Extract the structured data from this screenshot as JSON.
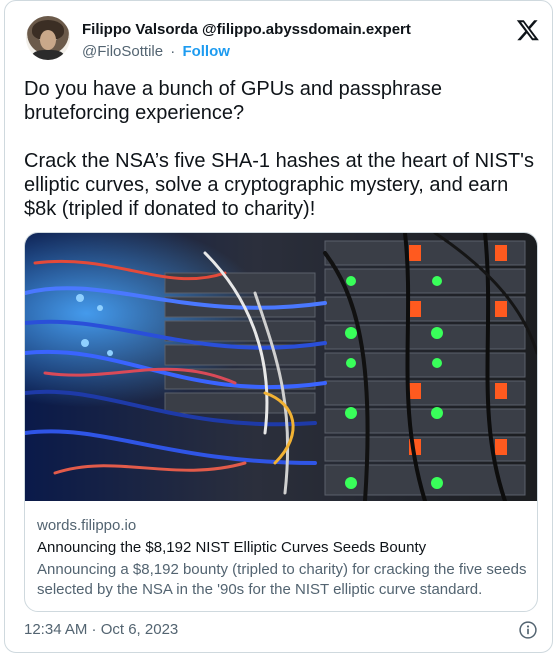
{
  "author": {
    "name": "Filippo Valsorda",
    "handle_display": "@filippo.abyssdomain.expert",
    "username": "@FiloSottile",
    "separator": "·",
    "follow_label": "Follow"
  },
  "tweet": {
    "paragraph1": "Do you have a bunch of GPUs and passphrase\nbruteforcing experience?",
    "paragraph2": "Crack the NSA’s five SHA-1 hashes at the heart of NIST's\nelliptic curves, solve a cryptographic mystery, and earn\n$8k (tripled if donated to charity)!"
  },
  "link_card": {
    "domain": "words.filippo.io",
    "title": "Announcing the $8,192 NIST Elliptic Curves Seeds Bounty",
    "description": "Announcing a $8,192 bounty (tripled to charity) for cracking the five seeds selected by the NSA in the '90s for the NIST elliptic curve standard.",
    "image_icon": "server-rack-photo"
  },
  "footer": {
    "timestamp": "12:34 AM · Oct 6, 2023",
    "info_icon": "info-icon"
  },
  "colors": {
    "accent": "#1d9bf0",
    "secondary_text": "#536471",
    "border": "#cfd9de"
  }
}
